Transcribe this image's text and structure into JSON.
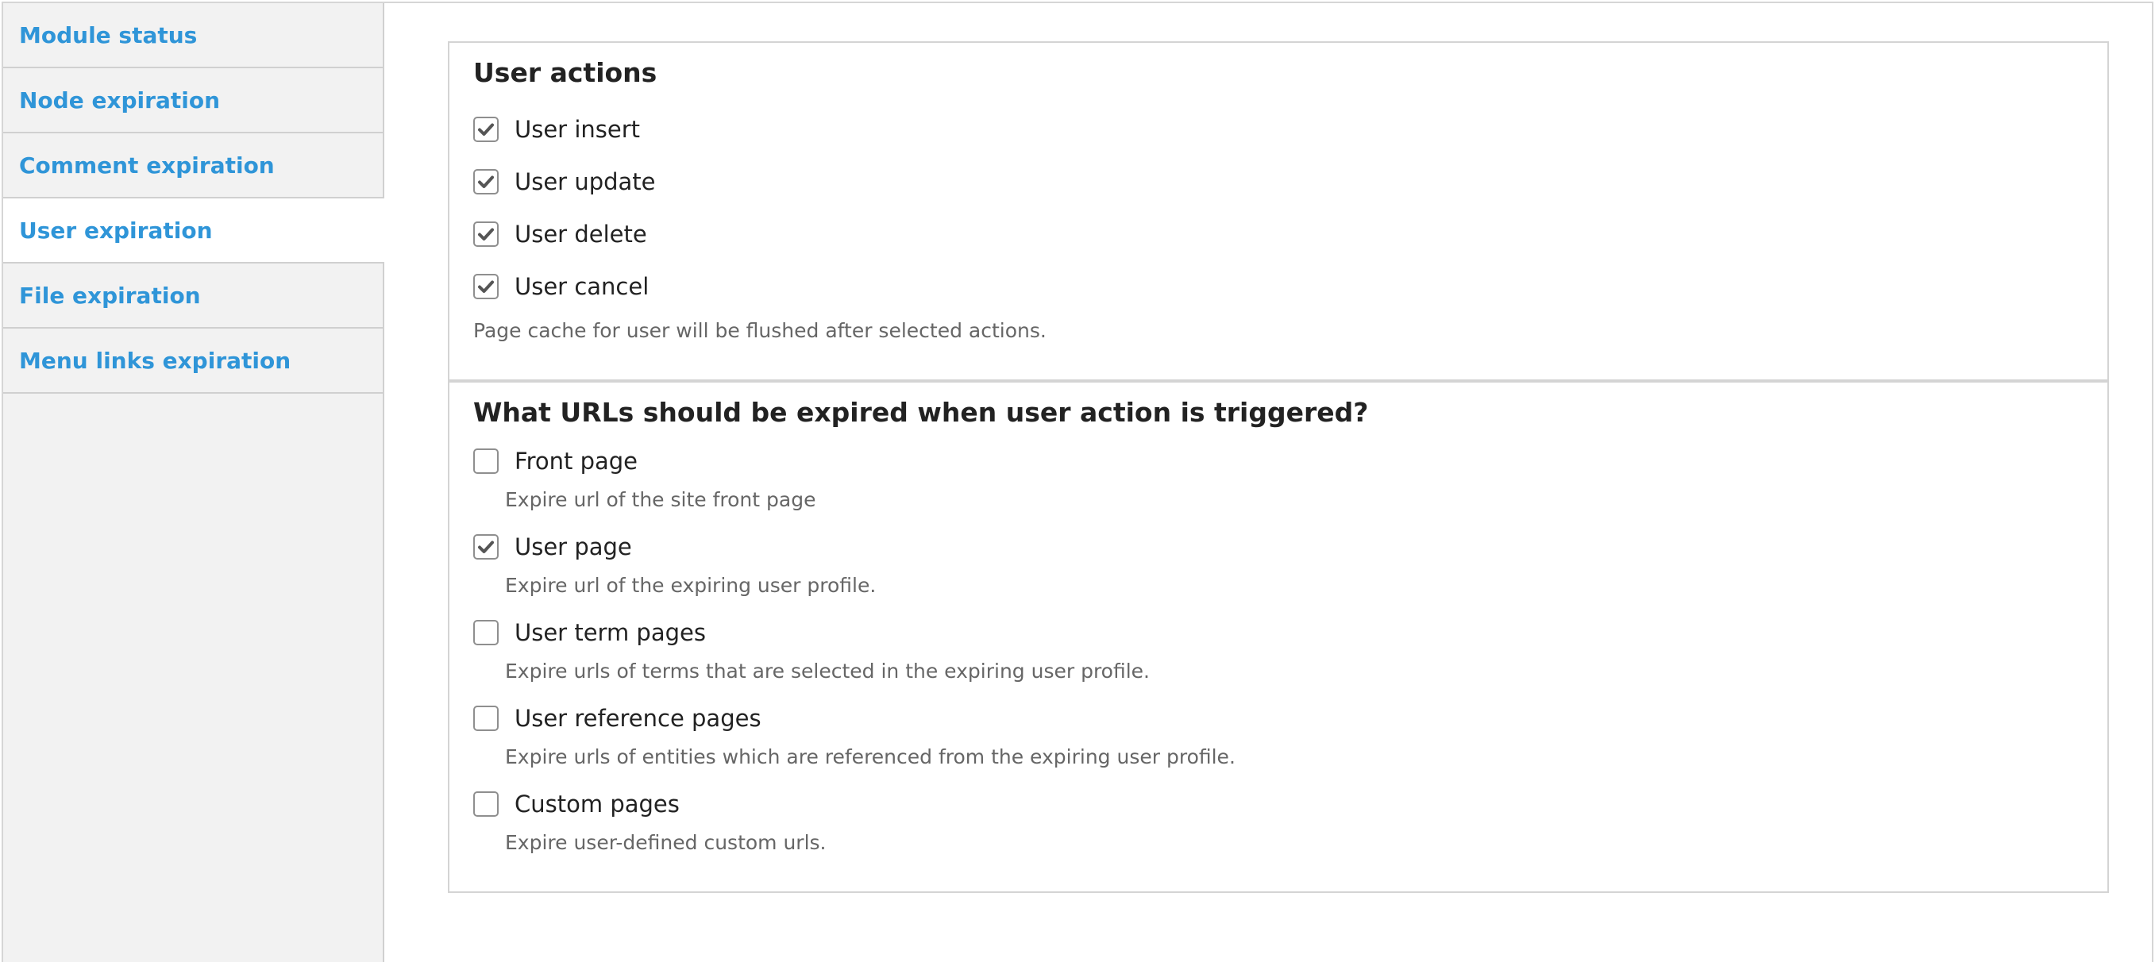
{
  "sidebar": {
    "tabs": [
      {
        "label": "Module status",
        "active": false
      },
      {
        "label": "Node expiration",
        "active": false
      },
      {
        "label": "Comment expiration",
        "active": false
      },
      {
        "label": "User expiration",
        "active": true
      },
      {
        "label": "File expiration",
        "active": false
      },
      {
        "label": "Menu links expiration",
        "active": false
      }
    ]
  },
  "user_actions": {
    "title": "User actions",
    "options": [
      {
        "label": "User insert",
        "checked": true
      },
      {
        "label": "User update",
        "checked": true
      },
      {
        "label": "User delete",
        "checked": true
      },
      {
        "label": "User cancel",
        "checked": true
      }
    ],
    "description": "Page cache for user will be flushed after selected actions."
  },
  "urls": {
    "title": "What URLs should be expired when user action is triggered?",
    "options": [
      {
        "label": "Front page",
        "checked": false,
        "description": "Expire url of the site front page"
      },
      {
        "label": "User page",
        "checked": true,
        "description": "Expire url of the expiring user profile."
      },
      {
        "label": "User term pages",
        "checked": false,
        "description": "Expire urls of terms that are selected in the expiring user profile."
      },
      {
        "label": "User reference pages",
        "checked": false,
        "description": "Expire urls of entities which are referenced from the expiring user profile."
      },
      {
        "label": "Custom pages",
        "checked": false,
        "description": "Expire user-defined custom urls."
      }
    ]
  },
  "colors": {
    "link": "#2f95d8",
    "sidebar_bg": "#f2f2f2",
    "border": "#d4d4d4",
    "text": "#222222",
    "description_text": "#666666",
    "checkmark": "#555555"
  },
  "icons": {
    "checkbox_checked": "checkmark-icon"
  }
}
